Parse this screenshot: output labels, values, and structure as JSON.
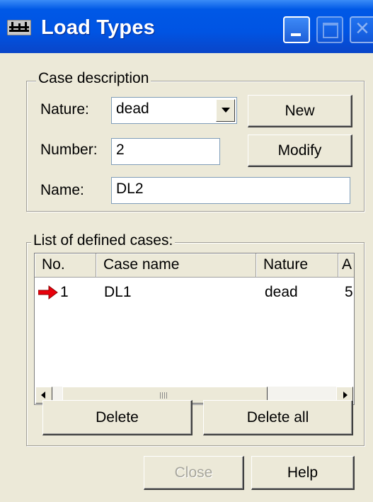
{
  "window": {
    "title": "Load Types",
    "controls": {
      "minimize": "minimize-icon",
      "maximize": "maximize-icon",
      "close": "close-icon"
    }
  },
  "case_description": {
    "legend": "Case description",
    "nature_label": "Nature:",
    "nature_value": "dead",
    "number_label": "Number:",
    "number_value": "2",
    "name_label": "Name:",
    "name_value": "DL2",
    "new_button": "New",
    "modify_button": "Modify"
  },
  "defined_cases": {
    "legend": "List of defined cases:",
    "columns": [
      "No.",
      "Case name",
      "Nature",
      "A"
    ],
    "rows": [
      {
        "no": "1",
        "case_name": "DL1",
        "nature": "dead",
        "extra": "5",
        "current": true
      }
    ],
    "scrollbar": {
      "position": 0.0
    },
    "delete_button": "Delete",
    "delete_all_button": "Delete all"
  },
  "footer": {
    "close_button": "Close",
    "help_button": "Help",
    "close_disabled": true
  },
  "colors": {
    "titlebar": "#0054e3",
    "dialog_bg": "#ece9d8",
    "current_marker": "#e8000b"
  }
}
